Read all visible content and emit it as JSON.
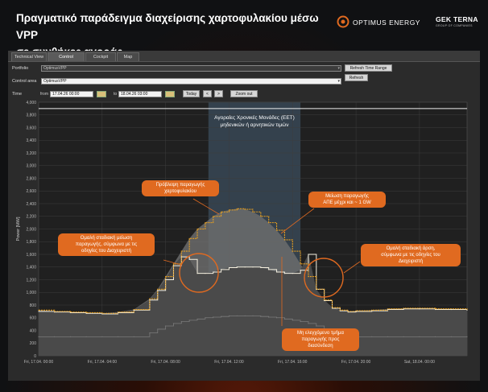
{
  "slide": {
    "title": "Πραγματικό παράδειγμα διαχείρισης χαρτοφυλακίου μέσω VPP\nσε συνθήκες αγοράς",
    "logo_optimus_text": "OPTIMUS ENERGY",
    "logo_gek_line1": "GEK TERNA",
    "logo_gek_line2": "GROUP OF COMPANIES",
    "accent_color": "#e06a20"
  },
  "tabs": [
    {
      "label": "Technical View",
      "active": false
    },
    {
      "label": "Control",
      "active": true
    },
    {
      "label": "Cockpit",
      "active": false
    },
    {
      "label": "Map",
      "active": false
    }
  ],
  "controls": {
    "portfolio_label": "Portfolio",
    "portfolio_value": "OptimusVPP",
    "refresh_time_range": "Refresh Time Range",
    "control_area_label": "Control area",
    "control_area_value": "OptimusVPP",
    "refresh": "Refresh",
    "time_label": "Time",
    "from_label": "from",
    "from_value": "17.04.26 00:00",
    "to_label": "to",
    "to_value": "18.04.26 03:00",
    "today": "Today",
    "prev": "<",
    "next": ">",
    "zoom_out": "Zoom out"
  },
  "annotations": {
    "eet_line1": "Αγοραίες Χρονικές Μονάδες (ΕΕΤ)",
    "eet_line2": "μηδενικών ή αρνητικών τιμών",
    "forecast": "Πρόβλεψη παραγωγής\nχαρτοφυλακίου",
    "reduction": "Μείωση παραγωγής\nΑΠΕ μέχρι και ~ 1 GW",
    "smooth_down": "Ομαλή σταδιακή μείωση\nπαραγωγής, σύμφωνα με τις\nοδηγίες του Διαχειριστή",
    "smooth_up": "Ομαλή σταδιακή άρση,\nσύμφωνα με τις οδηγίες του\nΔιαχειριστή",
    "uncontrolled": "Μη ελεγχόμενο τμήμα\nπαραγωγής προς\nδιασύνδεση"
  },
  "chart_data": {
    "type": "line",
    "ylabel": "Power [MW]",
    "ylim": [
      0,
      4000
    ],
    "y_ticks": [
      "0",
      "200",
      "400",
      "600",
      "800",
      "1,000",
      "1,200",
      "1,400",
      "1,600",
      "1,800",
      "2,000",
      "2,200",
      "2,400",
      "2,600",
      "2,800",
      "3,000",
      "3,200",
      "3,400",
      "3,600",
      "3,800",
      "4,000"
    ],
    "x_ticks": [
      "Fri, 17.04. 00:00",
      "Fri, 17.04. 04:00",
      "Fri, 17.04. 08:00",
      "Fri, 17.04. 12:00",
      "Fri, 17.04. 16:00",
      "Fri, 17.04. 20:00",
      "Sat, 18.04. 00:00"
    ],
    "x_range_hours": [
      0,
      27
    ],
    "highlight_hours": [
      10.7,
      16.5
    ],
    "reference_line": 3900,
    "x": [
      0,
      1,
      2,
      3,
      4,
      5,
      6,
      7,
      7.5,
      8,
      8.5,
      9,
      9.5,
      10,
      10.5,
      11,
      11.5,
      12,
      12.5,
      13,
      13.5,
      14,
      14.5,
      15,
      15.5,
      16,
      16.5,
      17,
      17.5,
      18,
      18.5,
      19,
      19.5,
      20,
      21,
      22,
      23,
      24,
      25,
      26,
      27
    ],
    "series": [
      {
        "name": "forecast",
        "color": "#e8a020",
        "values": [
          720,
          700,
          690,
          680,
          670,
          690,
          730,
          900,
          1050,
          1250,
          1450,
          1650,
          1850,
          2000,
          2100,
          2200,
          2270,
          2300,
          2320,
          2310,
          2270,
          2200,
          2100,
          1980,
          1830,
          1650,
          1450,
          1250,
          1050,
          880,
          760,
          720,
          700,
          710,
          720,
          740,
          750,
          750,
          740,
          740,
          730
        ]
      },
      {
        "name": "actual",
        "color": "#f5f0e0",
        "values": [
          700,
          690,
          680,
          670,
          660,
          680,
          720,
          880,
          1030,
          1200,
          1420,
          1560,
          1520,
          1300,
          1300,
          1320,
          1360,
          1390,
          1400,
          1400,
          1400,
          1390,
          1360,
          1320,
          1300,
          1300,
          1350,
          1600,
          1050,
          870,
          750,
          710,
          690,
          700,
          710,
          730,
          740,
          740,
          730,
          730,
          720
        ]
      },
      {
        "name": "uncontrolled",
        "color": "#7a7a7a",
        "values": [
          300,
          300,
          300,
          300,
          300,
          300,
          300,
          360,
          420,
          470,
          510,
          540,
          560,
          580,
          600,
          610,
          620,
          630,
          630,
          630,
          630,
          620,
          610,
          600,
          580,
          560,
          540,
          510,
          470,
          420,
          360,
          320,
          300,
          300,
          300,
          300,
          300,
          300,
          300,
          300,
          300
        ]
      }
    ]
  }
}
